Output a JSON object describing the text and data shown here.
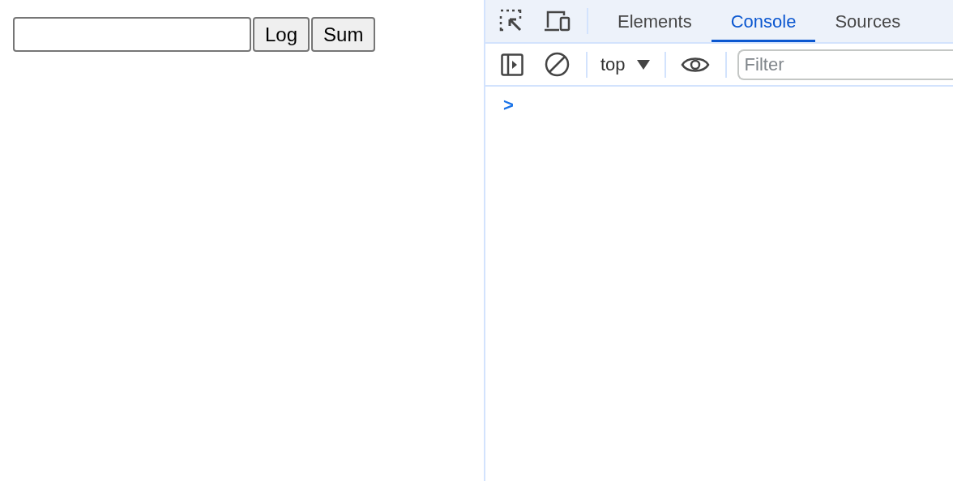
{
  "page": {
    "buttons": [
      "Log",
      "Sum"
    ]
  },
  "devtools": {
    "tabs": [
      {
        "label": "Elements",
        "selected": false
      },
      {
        "label": "Console",
        "selected": true
      },
      {
        "label": "Sources",
        "selected": false
      }
    ],
    "context": "top",
    "filter": {
      "placeholder": "Filter"
    },
    "prompt": ">"
  }
}
